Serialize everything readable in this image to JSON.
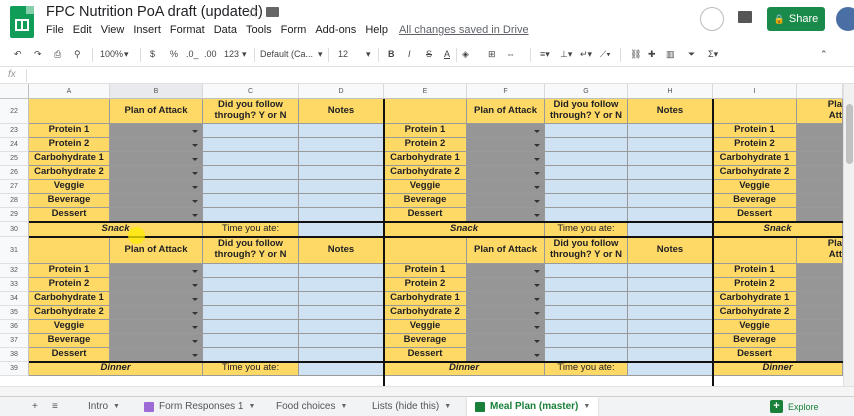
{
  "doc": {
    "title": "FPC Nutrition PoA draft (updated)",
    "saved_status": "All changes saved in Drive"
  },
  "menu": [
    "File",
    "Edit",
    "View",
    "Insert",
    "Format",
    "Data",
    "Tools",
    "Form",
    "Add-ons",
    "Help"
  ],
  "share_label": "Share",
  "toolbar": {
    "zoom": "100%",
    "currency": "$",
    "percent": "%",
    "dec_less": ".0_",
    "dec_more": ".00",
    "format_more": "123",
    "font": "Default (Ca...",
    "size": "12",
    "bold": "B",
    "italic": "I",
    "strike": "S",
    "text_color": "A"
  },
  "formula_label": "fx",
  "columns": [
    "A",
    "B",
    "C",
    "D",
    "E",
    "F",
    "G",
    "H",
    "I"
  ],
  "rows": [
    "22",
    "23",
    "24",
    "25",
    "26",
    "27",
    "28",
    "29",
    "30",
    "31",
    "32",
    "33",
    "34",
    "35",
    "36",
    "37",
    "38",
    "39"
  ],
  "headers": {
    "plan": "Plan of Attack",
    "follow_1": "Did you follow",
    "follow_2": "through? Y or N",
    "notes": "Notes",
    "plan_partial_1": "Pla",
    "plan_partial_2": "Att"
  },
  "foods": [
    "Protein 1",
    "Protein 2",
    "Carbohydrate 1",
    "Carbohydrate 2",
    "Veggie",
    "Beverage",
    "Dessert"
  ],
  "meals": {
    "snack": "Snack",
    "dinner": "Dinner"
  },
  "time_label": "Time you ate:",
  "sheets": [
    {
      "name": "Intro"
    },
    {
      "name": "Form Responses 1"
    },
    {
      "name": "Food choices"
    },
    {
      "name": "Lists (hide this)"
    },
    {
      "name": "Meal Plan (master)"
    }
  ],
  "explore_label": "Explore",
  "colors": {
    "yellow": "#ffd966",
    "gray": "#969696",
    "blue": "#cfe2f3",
    "share_green": "#1a8a4a"
  }
}
